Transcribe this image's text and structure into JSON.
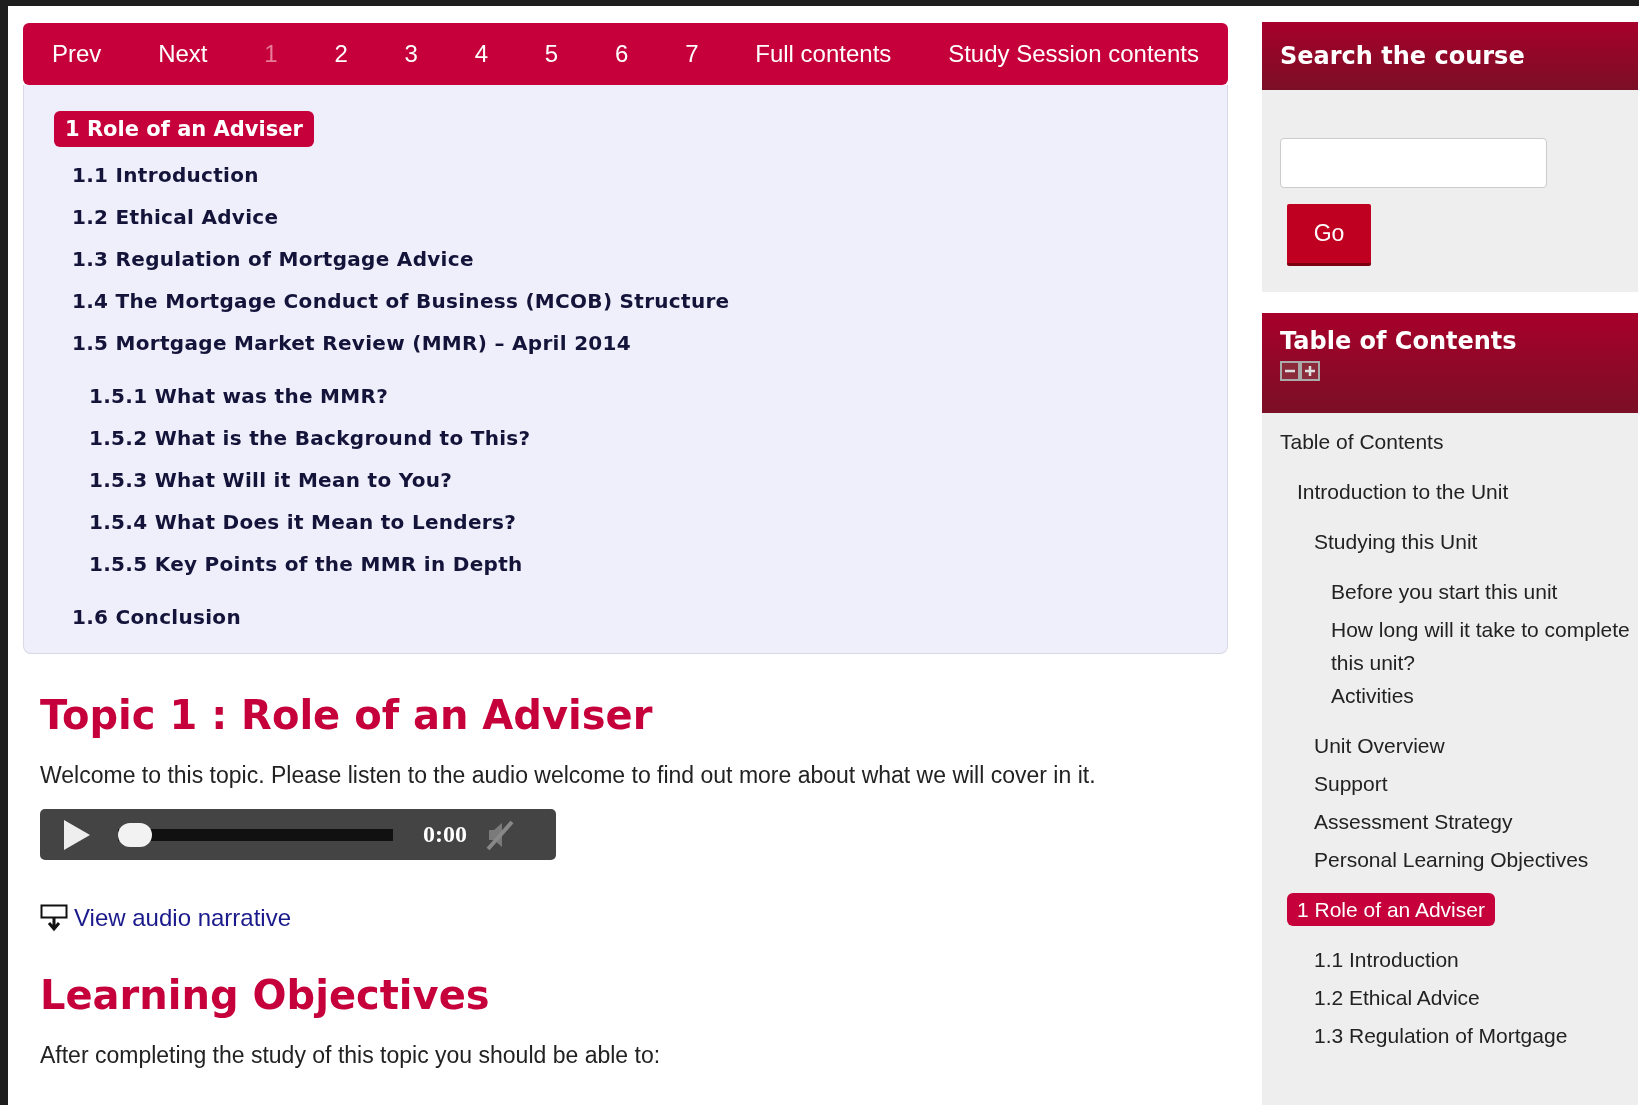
{
  "nav": [
    {
      "label": "Prev",
      "selected": false
    },
    {
      "label": "Next",
      "selected": false
    },
    {
      "label": "1",
      "selected": true
    },
    {
      "label": "2",
      "selected": false
    },
    {
      "label": "3",
      "selected": false
    },
    {
      "label": "4",
      "selected": false
    },
    {
      "label": "5",
      "selected": false
    },
    {
      "label": "6",
      "selected": false
    },
    {
      "label": "7",
      "selected": false
    },
    {
      "label": "Full contents",
      "selected": false
    },
    {
      "label": "Study Session contents",
      "selected": false
    }
  ],
  "outline": {
    "title": "1 Role of an Adviser",
    "items": [
      {
        "label": "1.1 Introduction"
      },
      {
        "label": "1.2 Ethical Advice"
      },
      {
        "label": "1.3 Regulation of Mortgage Advice"
      },
      {
        "label": "1.4 The Mortgage Conduct of Business (MCOB) Structure"
      },
      {
        "label": "1.5 Mortgage Market Review (MMR) – April 2014",
        "children": [
          {
            "label": "1.5.1 What was the MMR?"
          },
          {
            "label": "1.5.2 What is the Background to This?"
          },
          {
            "label": "1.5.3 What Will it Mean to You?"
          },
          {
            "label": "1.5.4 What Does it Mean to Lenders?"
          },
          {
            "label": "1.5.5 Key Points of the MMR in Depth"
          }
        ]
      },
      {
        "label": "1.6 Conclusion"
      }
    ]
  },
  "topic": {
    "heading": "Topic 1 : Role of an Adviser",
    "intro": "Welcome to this topic. Please listen to the audio welcome to find out more about what we will cover in it.",
    "audio": {
      "level": 0,
      "time": "0:00"
    },
    "narrative_link": "View audio narrative"
  },
  "objectives": {
    "heading": "Learning Objectives",
    "intro": "After completing the study of this topic you should be able to:"
  },
  "sidebar": {
    "search": {
      "title": "Search the course",
      "button": "Go"
    },
    "toc": {
      "title": "Table of Contents",
      "items": [
        {
          "label": "Table of Contents",
          "selected": false,
          "children": [
            {
              "label": "Introduction to the Unit",
              "selected": false,
              "children": [
                {
                  "label": "Studying this Unit",
                  "selected": false,
                  "children": [
                    {
                      "label": "Before you start this unit",
                      "selected": false
                    },
                    {
                      "label": "How long will it take to complete this unit?",
                      "selected": false
                    },
                    {
                      "label": "Activities",
                      "selected": false
                    }
                  ]
                },
                {
                  "label": "Unit Overview",
                  "selected": false
                },
                {
                  "label": "Support",
                  "selected": false
                },
                {
                  "label": "Assessment Strategy",
                  "selected": false
                },
                {
                  "label": "Personal Learning Objectives",
                  "selected": false
                }
              ]
            },
            {
              "label": "1 Role of an Adviser",
              "selected": true,
              "children": [
                {
                  "label": "1.1 Introduction",
                  "selected": false
                },
                {
                  "label": "1.2 Ethical Advice",
                  "selected": false
                },
                {
                  "label": "1.3 Regulation of Mortgage",
                  "selected": false
                }
              ]
            }
          ]
        }
      ]
    }
  }
}
